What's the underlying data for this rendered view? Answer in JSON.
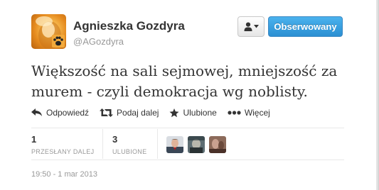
{
  "user": {
    "name": "Agnieszka Gozdyra",
    "handle": "@AGozdyra"
  },
  "buttons": {
    "follow_label": "Obserwowany"
  },
  "tweet": {
    "line1": "Większość na sali sejmowej, mniejszość za",
    "line2": "murem - czyli demokracja wg noblisty."
  },
  "actions": {
    "reply": "Odpowiedź",
    "retweet": "Podaj dalej",
    "favorite": "Ulubione",
    "more": "Więcej"
  },
  "stats": {
    "retweets_count": "1",
    "retweets_label": "PRZESŁANY DALEJ",
    "favorites_count": "3",
    "favorites_label": "ULUBIONE"
  },
  "timestamp": "19:50 - 1 mar 2013",
  "colors": {
    "follow_button": "#2b8fd2",
    "text": "#333333",
    "muted": "#999999"
  },
  "icons": [
    "paw-icon",
    "user-icon",
    "caret-down-icon",
    "reply-icon",
    "retweet-icon",
    "star-icon",
    "more-icon"
  ]
}
